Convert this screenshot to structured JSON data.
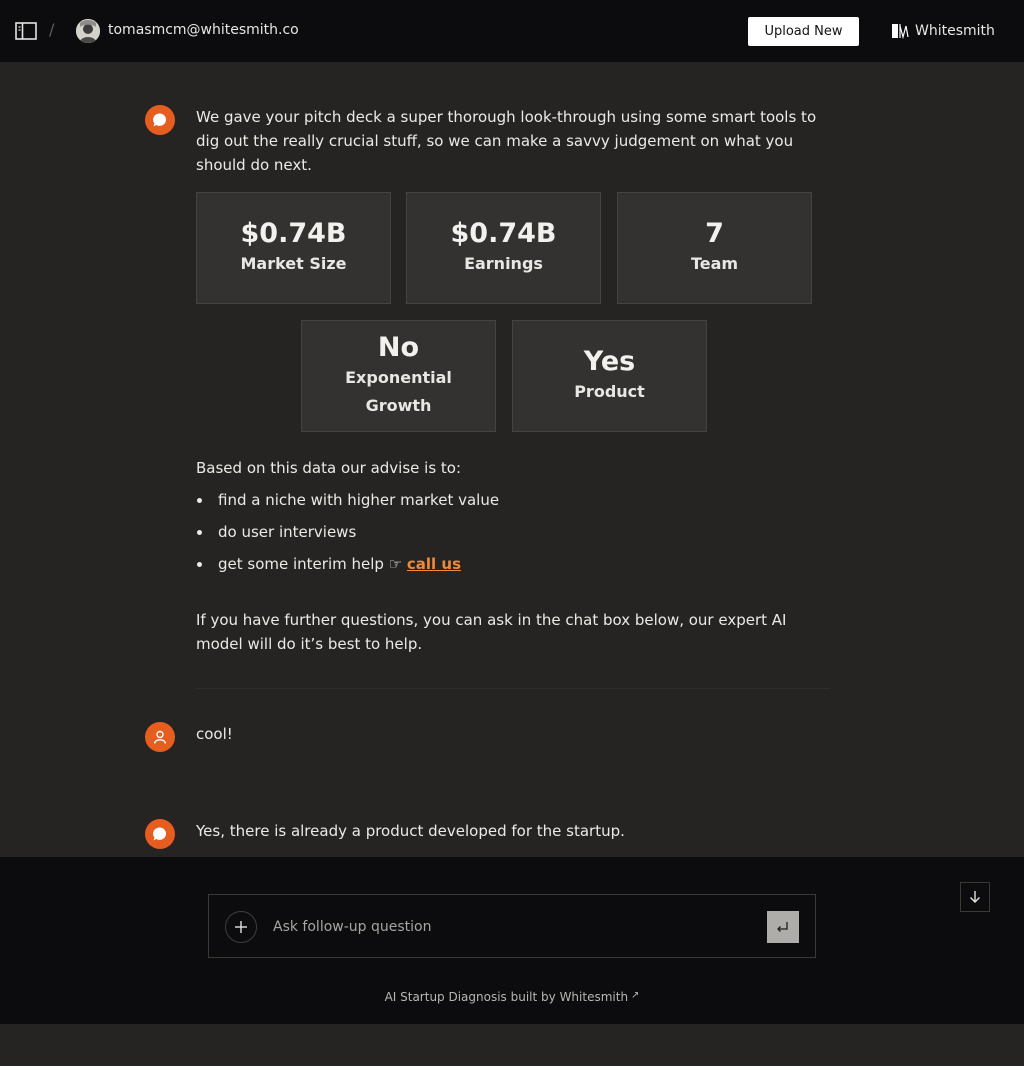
{
  "header": {
    "separator": "/",
    "user_email": "tomasmcm@whitesmith.co",
    "upload_label": "Upload New",
    "brand_name": "Whitesmith"
  },
  "conversation": {
    "intro": "We gave your pitch deck a super thorough look-through using some smart tools to dig out the really crucial stuff, so we can make a savvy judgement on what you should do next.",
    "stats": [
      {
        "value": "$0.74B",
        "label": "Market Size"
      },
      {
        "value": "$0.74B",
        "label": "Earnings"
      },
      {
        "value": "7",
        "label": "Team"
      },
      {
        "value": "No",
        "label": "Exponential Growth"
      },
      {
        "value": "Yes",
        "label": "Product"
      }
    ],
    "advice_intro": "Based on this data our advise is to:",
    "advice": [
      "find a niche with higher market value",
      "do user interviews",
      "get some interim help ☞ "
    ],
    "advice_link": "call us",
    "closing": "If you have further questions, you can ask in the chat box below, our expert AI model will do it’s best to help.",
    "user_message": "cool!",
    "bot_reply": "Yes, there is already a product developed for the startup."
  },
  "composer": {
    "placeholder": "Ask follow-up question",
    "value": ""
  },
  "footer": {
    "credit": "AI Startup Diagnosis built by Whitesmith",
    "credit_arrow": "↗"
  },
  "colors": {
    "accent": "#e55d1f",
    "link": "#ef8a3a",
    "background": "#252422",
    "bar": "#0c0c0e"
  }
}
